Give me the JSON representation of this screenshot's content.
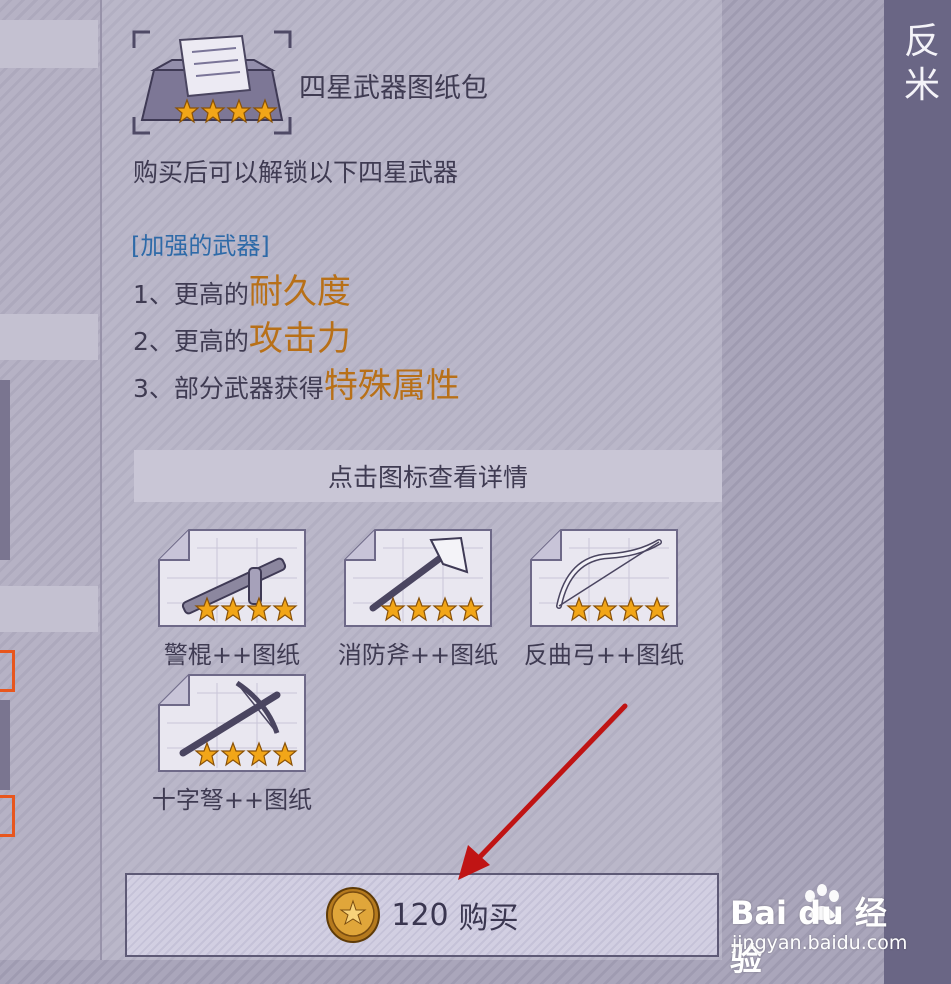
{
  "pack": {
    "title": "四星武器图纸包",
    "stars": 4,
    "description": "购买后可以解锁以下四星武器"
  },
  "section": {
    "title": "[加强的武器]",
    "features": [
      {
        "prefix": "1、更高的",
        "highlight": "耐久度"
      },
      {
        "prefix": "2、更高的",
        "highlight": "攻击力"
      },
      {
        "prefix": "3、部分武器获得",
        "highlight": "特殊属性"
      }
    ]
  },
  "detail_bar": {
    "label": "点击图标查看详情"
  },
  "weapons": [
    {
      "name": "警棍++图纸",
      "icon": "baton-blueprint-icon",
      "stars": 4
    },
    {
      "name": "消防斧++图纸",
      "icon": "fire-axe-blueprint-icon",
      "stars": 4
    },
    {
      "name": "反曲弓++图纸",
      "icon": "recurve-bow-blueprint-icon",
      "stars": 4
    },
    {
      "name": "十字弩++图纸",
      "icon": "crossbow-blueprint-icon",
      "stars": 4
    }
  ],
  "buy": {
    "price": "120",
    "label": "购买",
    "icon": "gold-coin-icon"
  },
  "right_panel": {
    "text": "反米"
  },
  "watermark": {
    "brand": "Bai du 经验",
    "url": "jingyan.baidu.com"
  },
  "colors": {
    "accent_highlight": "#b87018",
    "section_title": "#2e6aa8",
    "star": "#f2a618",
    "arrow": "#c01414"
  }
}
